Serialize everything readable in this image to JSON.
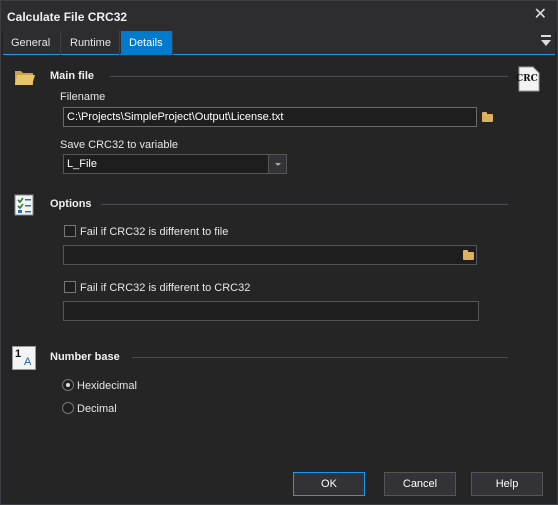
{
  "window": {
    "title": "Calculate File CRC32"
  },
  "tabs": [
    {
      "label": "General"
    },
    {
      "label": "Runtime"
    },
    {
      "label": "Details"
    }
  ],
  "main_file": {
    "title": "Main file",
    "filename_label": "Filename",
    "filename_value": "C:\\Projects\\SimpleProject\\Output\\License.txt",
    "save_label": "Save CRC32 to variable",
    "save_value": "L_File",
    "crc_badge": "CRC"
  },
  "options": {
    "title": "Options",
    "fail_file_label": "Fail if CRC32 is different to file",
    "fail_file_value": "",
    "fail_crc_label": "Fail if CRC32 is different to CRC32",
    "fail_crc_value": ""
  },
  "number_base": {
    "title": "Number base",
    "icon_one": "1",
    "icon_a": "A",
    "options": [
      "Hexidecimal",
      "Decimal"
    ],
    "selected": "Hexidecimal"
  },
  "footer": {
    "ok": "OK",
    "cancel": "Cancel",
    "help": "Help"
  },
  "colors": {
    "accent": "#007acc",
    "background": "#252526",
    "titlebar": "#2d2d30"
  }
}
